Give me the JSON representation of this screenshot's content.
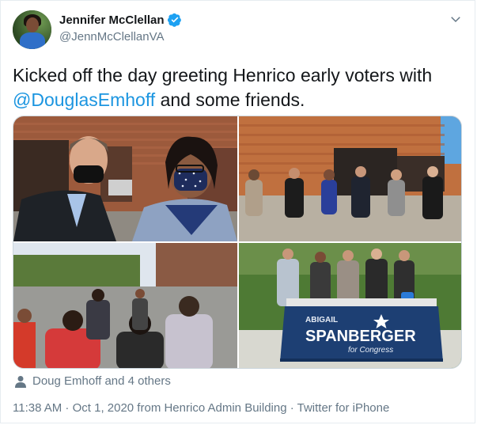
{
  "tweet": {
    "author_name": "Jennifer McClellan",
    "author_handle": "@JennMcClellanVA",
    "text_before": "Kicked off the day greeting Henrico early voters with ",
    "mention": "@DouglasEmhoff",
    "text_after": " and some friends.",
    "tagged_people": "Doug Emhoff and 4 others",
    "timestamp": "11:38 AM · Oct 1, 2020 from Henrico Admin Building · Twitter for iPhone"
  },
  "media": {
    "sign_line1": "ABIGAIL",
    "sign_line2": "SPANBERGER",
    "sign_line3": "for Congress"
  },
  "colors": {
    "link": "#1b95e0",
    "secondary_text": "#657786",
    "verified": "#1da1f2"
  },
  "icons": [
    "verified-badge-icon",
    "chevron-down-icon",
    "person-icon"
  ]
}
